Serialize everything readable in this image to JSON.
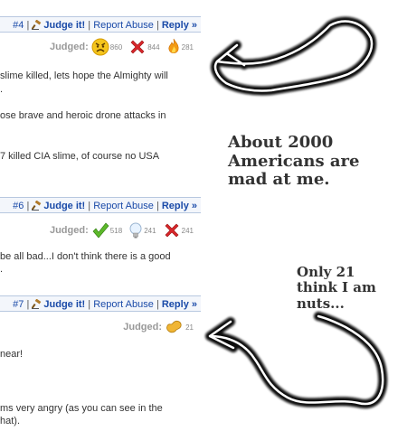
{
  "comments": [
    {
      "number": "#4",
      "judge_label": "Judge it!",
      "report_label": "Report Abuse",
      "reply_label": "Reply »",
      "judged_label": "Judged:",
      "ratings": [
        {
          "icon": "angry-face-icon",
          "count": "860"
        },
        {
          "icon": "red-x-icon",
          "count": "844"
        },
        {
          "icon": "flame-icon",
          "count": "281"
        }
      ],
      "lines": [
        "slime killed, lets hope the Almighty will",
        ".",
        "ose brave and heroic drone attacks in",
        "7 killed CIA slime, of course no USA"
      ]
    },
    {
      "number": "#6",
      "judge_label": "Judge it!",
      "report_label": "Report Abuse",
      "reply_label": "Reply »",
      "judged_label": "Judged:",
      "ratings": [
        {
          "icon": "green-check-icon",
          "count": "518"
        },
        {
          "icon": "lightbulb-icon",
          "count": "241"
        },
        {
          "icon": "red-x-icon",
          "count": "241"
        }
      ],
      "lines": [
        "be all bad...I don't think there is a good",
        "."
      ]
    },
    {
      "number": "#7",
      "judge_label": "Judge it!",
      "report_label": "Report Abuse",
      "reply_label": "Reply »",
      "judged_label": "Judged:",
      "ratings": [
        {
          "icon": "peanut-icon",
          "count": "21"
        }
      ],
      "lines": [
        "near!",
        "ms very angry (as you can see in the",
        "hat)."
      ]
    }
  ],
  "annotations": {
    "caption_top": [
      "About 2000",
      "Americans are",
      "mad at me."
    ],
    "caption_bottom": [
      "Only 21",
      "think I am",
      "nuts..."
    ]
  }
}
